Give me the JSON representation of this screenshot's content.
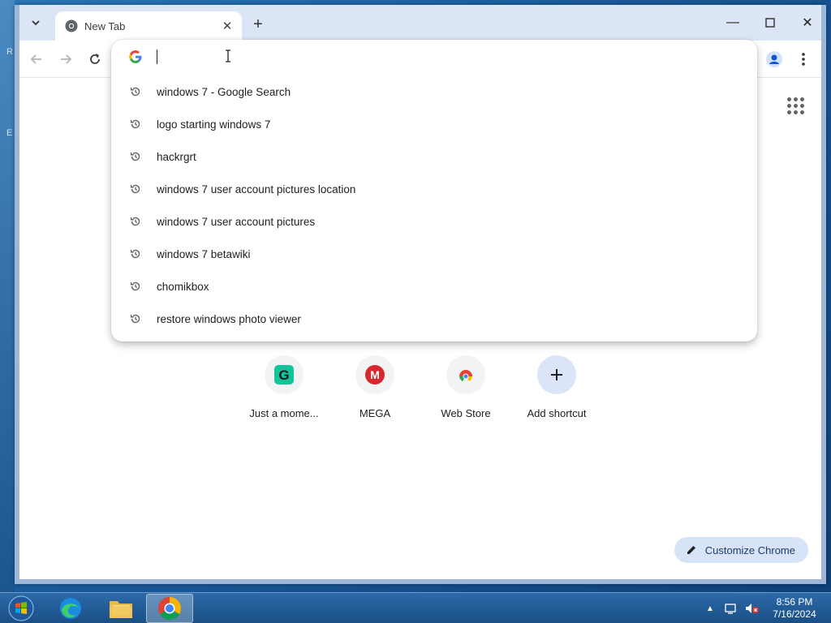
{
  "desktop": {
    "left_edge_fragments": [
      "R",
      "E"
    ]
  },
  "browser": {
    "tab": {
      "title": "New Tab"
    },
    "window_controls": {
      "minimize": "—",
      "maximize": "☐",
      "close": "✕"
    },
    "omnibox": {
      "value": "",
      "placeholder": "",
      "suggestions": [
        "windows 7 - Google Search",
        "logo starting windows 7",
        "hackrgrt",
        "windows 7 user account pictures location",
        "windows 7 user account pictures",
        "windows 7 betawiki",
        "chomikbox",
        "restore windows photo viewer"
      ]
    },
    "shortcuts": [
      {
        "label": "Just a mome...",
        "icon": "grammarly-g-icon"
      },
      {
        "label": "MEGA",
        "icon": "mega-icon"
      },
      {
        "label": "Web Store",
        "icon": "chrome-web-store-icon"
      },
      {
        "label": "Add shortcut",
        "icon": "plus-icon"
      }
    ],
    "customize_label": "Customize Chrome"
  },
  "taskbar": {
    "clock_time": "8:56 PM",
    "clock_date": "7/16/2024"
  }
}
